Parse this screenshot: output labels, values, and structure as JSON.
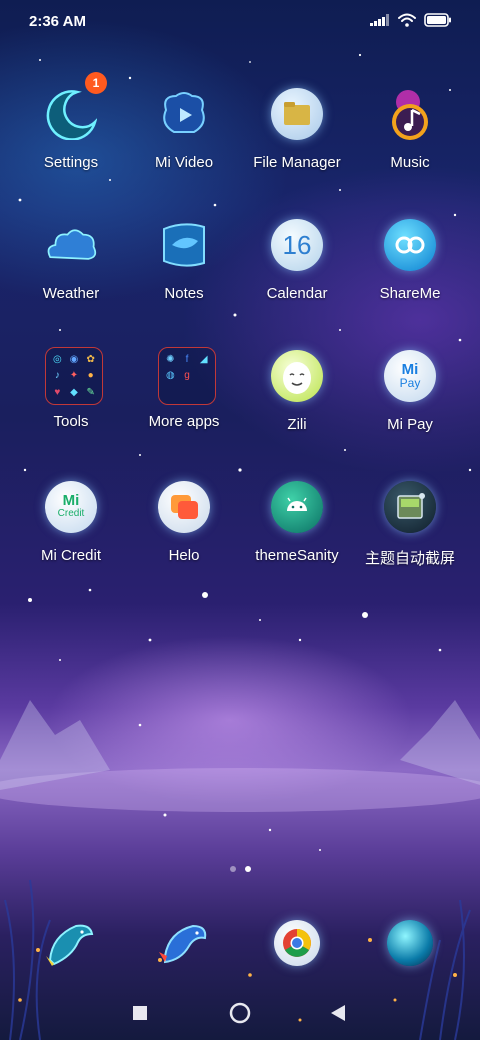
{
  "status": {
    "time": "2:36 AM"
  },
  "apps": [
    {
      "label": "Settings",
      "icon": "crescent-moon-icon",
      "badge": "1"
    },
    {
      "label": "Mi Video",
      "icon": "video-icon"
    },
    {
      "label": "File Manager",
      "icon": "folder-icon"
    },
    {
      "label": "Music",
      "icon": "music-note-icon"
    },
    {
      "label": "Weather",
      "icon": "cloud-icon"
    },
    {
      "label": "Notes",
      "icon": "notes-icon"
    },
    {
      "label": "Calendar",
      "icon": "calendar-icon",
      "date": "16"
    },
    {
      "label": "ShareMe",
      "icon": "shareme-icon"
    },
    {
      "label": "Tools",
      "icon": "folder-tools-icon"
    },
    {
      "label": "More apps",
      "icon": "folder-more-apps-icon"
    },
    {
      "label": "Zili",
      "icon": "zili-icon"
    },
    {
      "label": "Mi Pay",
      "icon": "mi-pay-icon",
      "glyph_top": "Mi",
      "glyph_bottom": "Pay"
    },
    {
      "label": "Mi Credit",
      "icon": "mi-credit-icon",
      "glyph_top": "Mi",
      "glyph_bottom": "Credit"
    },
    {
      "label": "Helo",
      "icon": "helo-icon"
    },
    {
      "label": "themeSanity",
      "icon": "android-icon"
    },
    {
      "label": "主题自动截屏",
      "icon": "screenshot-icon"
    }
  ],
  "dock": [
    {
      "icon": "phone-dolphin-icon"
    },
    {
      "icon": "messages-dolphin-icon"
    },
    {
      "icon": "chrome-icon"
    },
    {
      "icon": "camera-orb-icon"
    }
  ],
  "pages": {
    "count": 2,
    "active": 2
  },
  "colors": {
    "badge": "#ff5a1f",
    "folder_border": "#c13838"
  }
}
